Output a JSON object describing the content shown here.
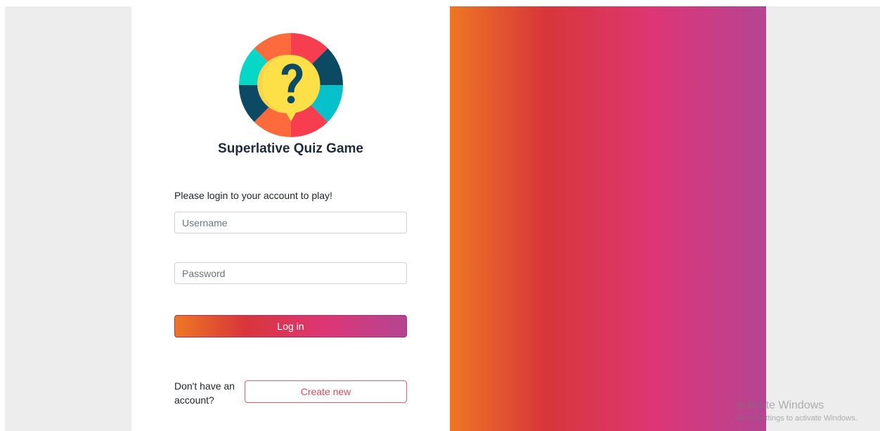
{
  "app": {
    "title": "Superlative Quiz Game",
    "logo_icon": "question-wheel-icon"
  },
  "login": {
    "prompt": "Please login to your account to play!",
    "username_placeholder": "Username",
    "username_value": "",
    "password_placeholder": "Password",
    "password_value": "",
    "login_label": "Log in"
  },
  "signup": {
    "text": "Don't have an account?",
    "create_label": "Create new"
  },
  "watermark": {
    "title": "Activate Windows",
    "subtitle": "Go to Settings to activate Windows."
  },
  "colors": {
    "gradient_start": "#ee7724",
    "gradient_mid1": "#d8363a",
    "gradient_mid2": "#dd3675",
    "gradient_end": "#b44593",
    "create_button_border": "#dc6470"
  }
}
